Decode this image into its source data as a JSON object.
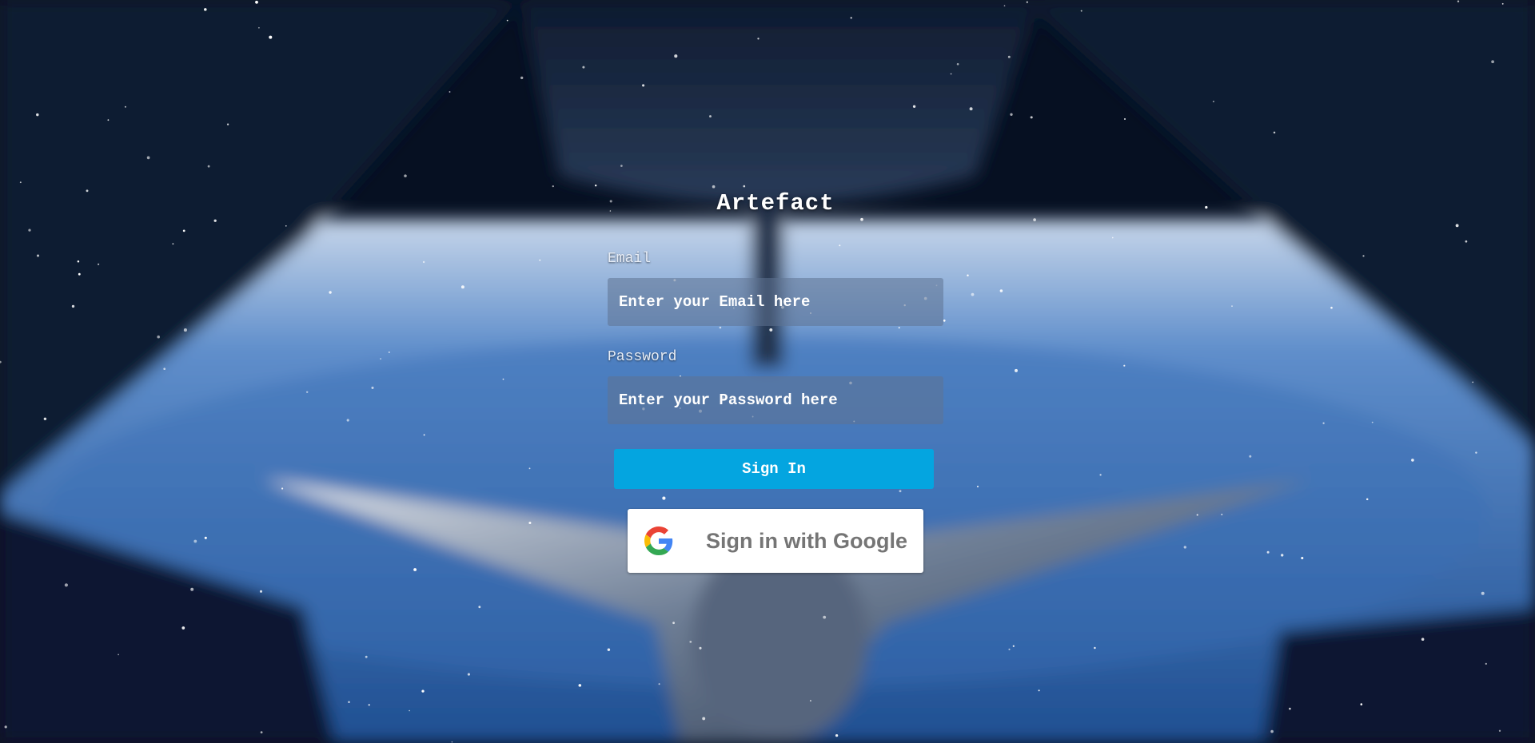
{
  "app": {
    "title": "Artefact"
  },
  "form": {
    "email_label": "Email",
    "email_placeholder": "Enter your Email here",
    "email_value": "",
    "password_label": "Password",
    "password_placeholder": "Enter your Password here",
    "password_value": "",
    "signin_label": "Sign In",
    "google_label": "Sign in with Google"
  },
  "icons": {
    "google": "google-g-icon"
  },
  "colors": {
    "signin_button": "#04a5e0",
    "input_background": "rgba(95,115,145,0.55)",
    "google_button": "#ffffff",
    "google_text": "#757575"
  }
}
